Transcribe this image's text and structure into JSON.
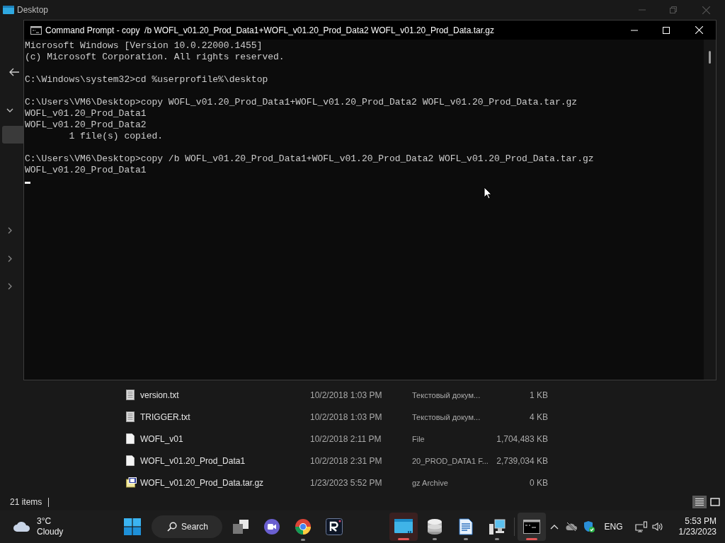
{
  "explorer": {
    "title": "Desktop",
    "files": [
      {
        "name": "version.txt",
        "date": "10/2/2018 1:03 PM",
        "type": "Текстовый докум...",
        "size": "1 KB",
        "kind": "text"
      },
      {
        "name": "TRIGGER.txt",
        "date": "10/2/2018 1:03 PM",
        "type": "Текстовый докум...",
        "size": "4 KB",
        "kind": "text"
      },
      {
        "name": "WOFL_v01",
        "date": "10/2/2018 2:11 PM",
        "type": "File",
        "size": "1,704,483 KB",
        "kind": "file"
      },
      {
        "name": "WOFL_v01.20_Prod_Data1",
        "date": "10/2/2018 2:31 PM",
        "type": "20_PROD_DATA1 F...",
        "size": "2,739,034 KB",
        "kind": "file"
      },
      {
        "name": "WOFL_v01.20_Prod_Data.tar.gz",
        "date": "1/23/2023 5:52 PM",
        "type": "gz Archive",
        "size": "0 KB",
        "kind": "archive"
      }
    ],
    "status": "21 items"
  },
  "cmd": {
    "title": "Command Prompt - copy  /b WOFL_v01.20_Prod_Data1+WOFL_v01.20_Prod_Data2 WOFL_v01.20_Prod_Data.tar.gz",
    "blocks": [
      {
        "lines": [
          "Microsoft Windows [Version 10.0.22000.1455]",
          "(c) Microsoft Corporation. All rights reserved."
        ]
      },
      {
        "lines": [
          "C:\\Windows\\system32>cd %userprofile%\\desktop"
        ]
      },
      {
        "lines": [
          "C:\\Users\\VM6\\Desktop>copy WOFL_v01.20_Prod_Data1+WOFL_v01.20_Prod_Data2 WOFL_v01.20_Prod_Data.tar.gz",
          "WOFL_v01.20_Prod_Data1",
          "WOFL_v01.20_Prod_Data2",
          "        1 file(s) copied."
        ]
      },
      {
        "lines": [
          "C:\\Users\\VM6\\Desktop>copy /b WOFL_v01.20_Prod_Data1+WOFL_v01.20_Prod_Data2 WOFL_v01.20_Prod_Data.tar.gz",
          "WOFL_v01.20_Prod_Data1"
        ]
      }
    ]
  },
  "taskbar": {
    "weather": {
      "temperature": "3°C",
      "condition": "Cloudy"
    },
    "search_label": "Search",
    "apps": [
      {
        "kind": "explorer",
        "open": true,
        "selected": true
      },
      {
        "kind": "database",
        "open": true,
        "selected": false
      },
      {
        "kind": "document",
        "open": true,
        "selected": false
      },
      {
        "kind": "network",
        "open": true,
        "selected": false
      },
      {
        "kind": "terminal",
        "open": true,
        "selected": true
      }
    ],
    "language": "ENG",
    "time": "5:53 PM",
    "date": "1/23/2023"
  }
}
